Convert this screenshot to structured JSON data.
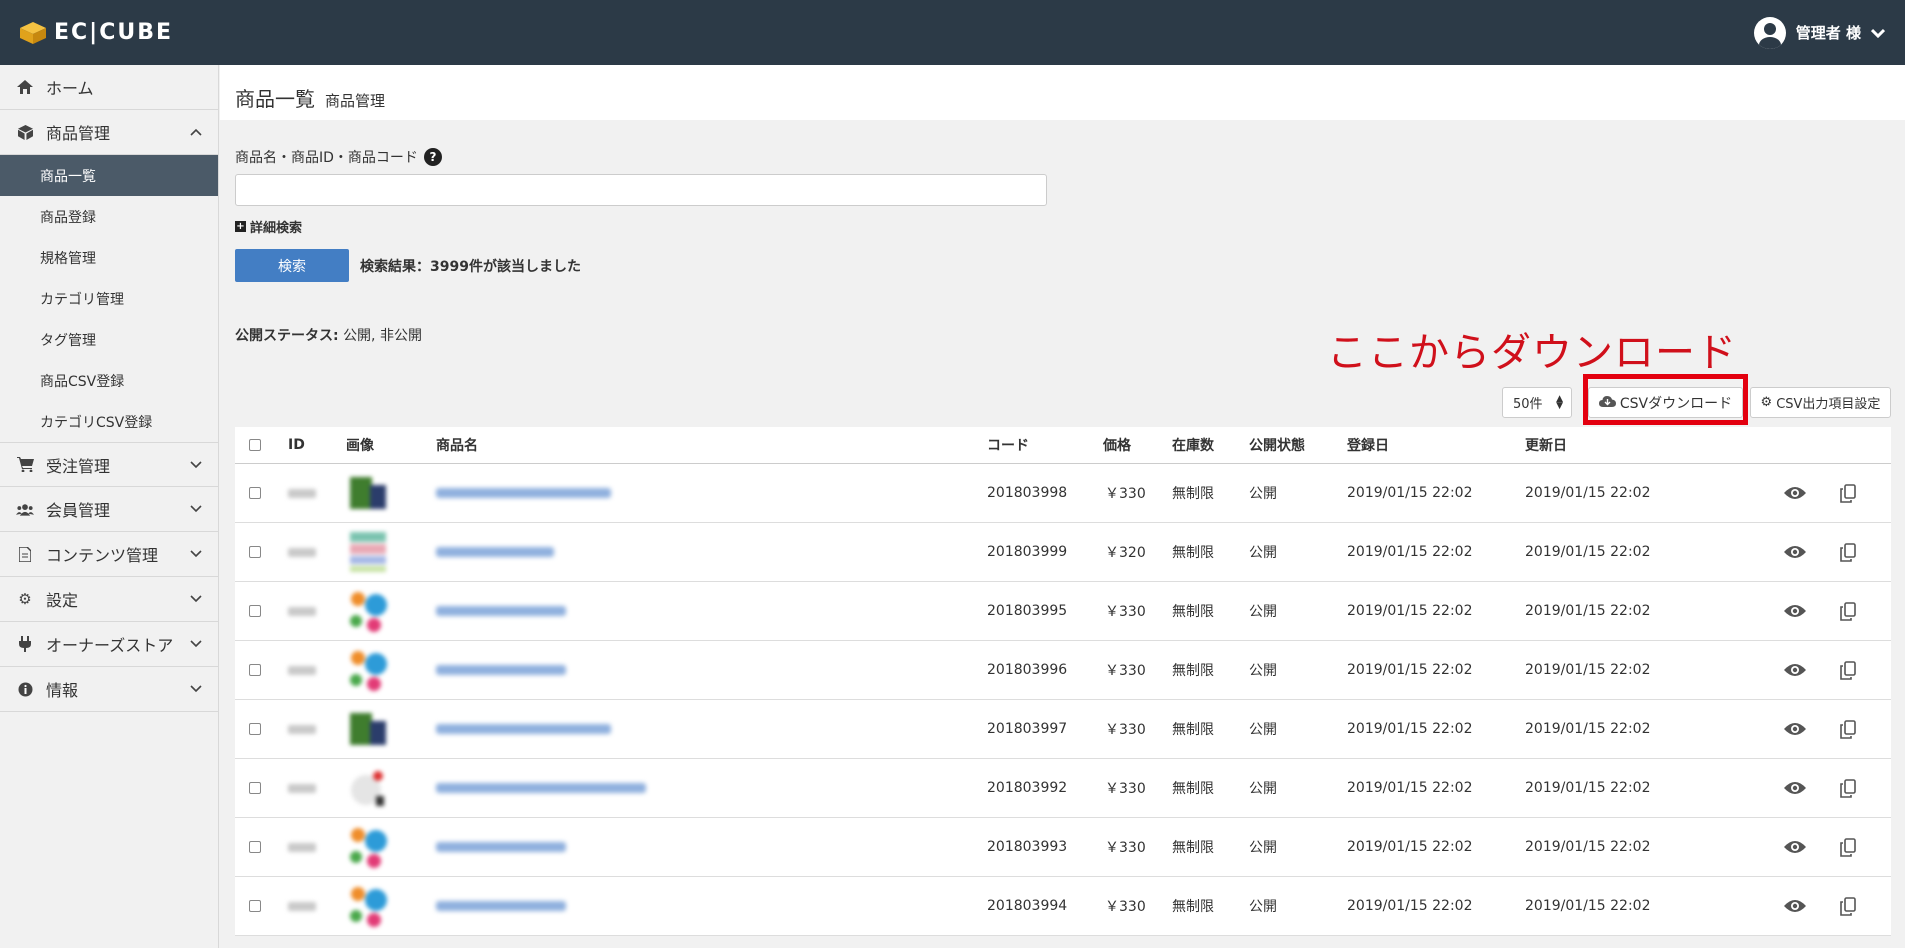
{
  "header": {
    "logo_text": "EC|CUBE",
    "user_label": "管理者 様"
  },
  "sidebar": {
    "items": [
      {
        "label": "ホーム",
        "icon": "home-icon"
      },
      {
        "label": "商品管理",
        "icon": "cube-icon",
        "expanded": true,
        "children": [
          "商品一覧",
          "商品登録",
          "規格管理",
          "カテゴリ管理",
          "タグ管理",
          "商品CSV登録",
          "カテゴリCSV登録"
        ],
        "active_child": "商品一覧"
      },
      {
        "label": "受注管理",
        "icon": "cart-icon"
      },
      {
        "label": "会員管理",
        "icon": "users-icon"
      },
      {
        "label": "コンテンツ管理",
        "icon": "document-icon"
      },
      {
        "label": "設定",
        "icon": "gear-icon"
      },
      {
        "label": "オーナーズストア",
        "icon": "plug-icon"
      },
      {
        "label": "情報",
        "icon": "info-icon"
      }
    ]
  },
  "page": {
    "title": "商品一覧",
    "subtitle": "商品管理"
  },
  "search": {
    "label": "商品名・商品ID・商品コード",
    "value": "",
    "detail_link": "詳細検索",
    "button": "検索",
    "result": "検索結果：3999件が該当しました"
  },
  "status_filter": {
    "label": "公開ステータス:",
    "value": "公開, 非公開"
  },
  "annotation": "ここからダウンロード",
  "toolbar": {
    "per_page": "50件",
    "csv_download": "CSVダウンロード",
    "csv_settings": "CSV出力項目設定"
  },
  "table": {
    "headers": [
      "ID",
      "画像",
      "商品名",
      "コード",
      "価格",
      "在庫数",
      "公開状態",
      "登録日",
      "更新日"
    ],
    "rows": [
      {
        "code": "201803998",
        "price": "￥330",
        "stock": "無制限",
        "status": "公開",
        "created": "2019/01/15 22:02",
        "updated": "2019/01/15 22:02",
        "name_w": 175,
        "thumb": "green"
      },
      {
        "code": "201803999",
        "price": "￥320",
        "stock": "無制限",
        "status": "公開",
        "created": "2019/01/15 22:02",
        "updated": "2019/01/15 22:02",
        "name_w": 118,
        "thumb": "stripe"
      },
      {
        "code": "201803995",
        "price": "￥330",
        "stock": "無制限",
        "status": "公開",
        "created": "2019/01/15 22:02",
        "updated": "2019/01/15 22:02",
        "name_w": 130,
        "thumb": "color"
      },
      {
        "code": "201803996",
        "price": "￥330",
        "stock": "無制限",
        "status": "公開",
        "created": "2019/01/15 22:02",
        "updated": "2019/01/15 22:02",
        "name_w": 130,
        "thumb": "color"
      },
      {
        "code": "201803997",
        "price": "￥330",
        "stock": "無制限",
        "status": "公開",
        "created": "2019/01/15 22:02",
        "updated": "2019/01/15 22:02",
        "name_w": 175,
        "thumb": "green"
      },
      {
        "code": "201803992",
        "price": "￥330",
        "stock": "無制限",
        "status": "公開",
        "created": "2019/01/15 22:02",
        "updated": "2019/01/15 22:02",
        "name_w": 210,
        "thumb": "white"
      },
      {
        "code": "201803993",
        "price": "￥330",
        "stock": "無制限",
        "status": "公開",
        "created": "2019/01/15 22:02",
        "updated": "2019/01/15 22:02",
        "name_w": 130,
        "thumb": "color"
      },
      {
        "code": "201803994",
        "price": "￥330",
        "stock": "無制限",
        "status": "公開",
        "created": "2019/01/15 22:02",
        "updated": "2019/01/15 22:02",
        "name_w": 130,
        "thumb": "color"
      }
    ]
  },
  "colors": {
    "header_bg": "#2c3a47",
    "primary_button": "#437ec4",
    "annotation_red": "#d0101b",
    "sidebar_active": "#4b5a68"
  }
}
